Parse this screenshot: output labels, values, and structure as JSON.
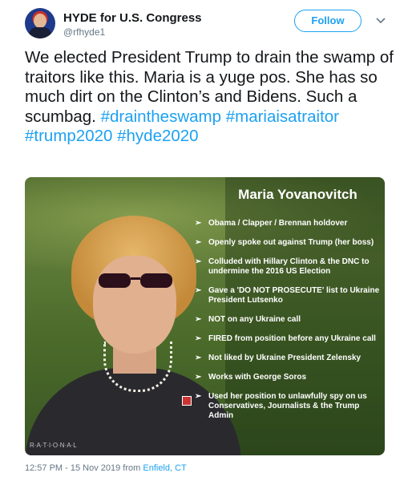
{
  "header": {
    "display_name": "HYDE for U.S. Congress",
    "handle": "@rfhyde1",
    "follow_label": "Follow"
  },
  "tweet": {
    "text": "We elected President Trump to drain the swamp of traitors like this. Maria is a yuge pos. She has so much dirt on the Clinton’s and Bidens. Such a scumbag.",
    "hashtags": [
      "#draintheswamp",
      "#mariaisatraitor",
      "#trump2020",
      "#hyde2020"
    ]
  },
  "media": {
    "title": "Maria Yovanovitch",
    "bullets": [
      "Obama / Clapper / Brennan holdover",
      "Openly spoke out against Trump (her boss)",
      "Colluded with Hillary Clinton & the DNC to undermine the 2016 US Election",
      "Gave a 'DO NOT PROSECUTE' list to Ukraine President Lutsenko",
      "NOT on any Ukraine call",
      "FIRED from position before any Ukraine call",
      "Not liked by Ukraine President Zelensky",
      "Works with George Soros",
      "Used her position to unlawfully spy on us Conservatives, Journalists & the Trump Admin"
    ],
    "watermark": "R·A·T·I·O·N·A·L"
  },
  "footer": {
    "timestamp": "12:57 PM - 15 Nov 2019 from",
    "location": "Enfield, CT"
  },
  "colors": {
    "link": "#1da1f2",
    "text": "#14171a",
    "muted": "#657786"
  }
}
